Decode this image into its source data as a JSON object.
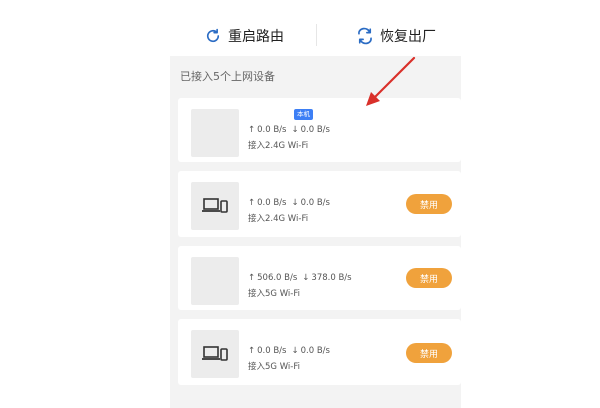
{
  "toolbar": {
    "restart_label": "重启路由",
    "reset_label": "恢复出厂"
  },
  "section": {
    "connected_label": "已接入5个上网设备"
  },
  "devices": [
    {
      "thumb": "",
      "name": "",
      "badge": "本机",
      "up": "0.0 B/s",
      "down": "0.0 B/s",
      "band": "接入2.4G Wi-Fi"
    },
    {
      "name": "",
      "up": "0.0 B/s",
      "down": "0.0 B/s",
      "band": "接入2.4G Wi-Fi",
      "action": "禁用"
    },
    {
      "thumb": "",
      "name": "",
      "up": "506.0 B/s",
      "down": "378.0 B/s",
      "band": "接入5G Wi-Fi",
      "action": "禁用"
    },
    {
      "name": "",
      "up": "0.0 B/s",
      "down": "0.0 B/s",
      "band": "接入5G Wi-Fi",
      "action": "禁用"
    }
  ],
  "icons": {
    "restart": "refresh-icon",
    "reset": "swap-arrows-icon",
    "laptop": "laptop-phone-icon",
    "up": "arrow-up-icon",
    "down": "arrow-down-icon"
  },
  "colors": {
    "accent": "#2b6cc4",
    "ban_button": "#f0a23c",
    "badge": "#3d7ff5",
    "annotation_arrow": "#d9302a"
  }
}
